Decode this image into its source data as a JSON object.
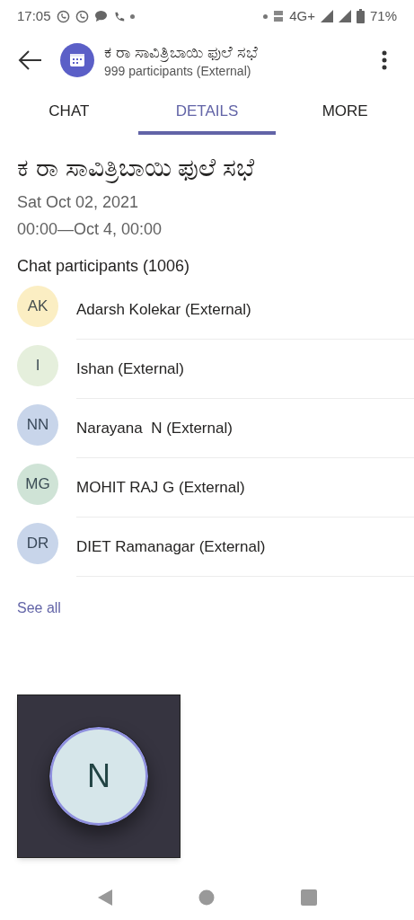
{
  "status_bar": {
    "time": "17:05",
    "network": "4G+",
    "battery": "71%"
  },
  "header": {
    "title": "ಕ ರಾ ಸಾವಿತ್ರಿಬಾಯಿ ಫುಲೆ ಸಭೆ",
    "subtitle": "999 participants (External)"
  },
  "tabs": [
    {
      "label": "CHAT",
      "selected": false
    },
    {
      "label": "DETAILS",
      "selected": true
    },
    {
      "label": "MORE",
      "selected": false
    }
  ],
  "details": {
    "title": "ಕ ರಾ ಸಾವಿತ್ರಿಬಾಯಿ ಫುಲೆ ಸಭೆ",
    "date": "Sat Oct 02, 2021",
    "time": "00:00—Oct 4, 00:00"
  },
  "participants": {
    "heading": "Chat participants (1006)",
    "items": [
      {
        "initials": "AK",
        "name": "Adarsh Kolekar (External)",
        "color": "#fbeec3"
      },
      {
        "initials": "I",
        "name": "Ishan (External)",
        "color": "#e5efdc"
      },
      {
        "initials": "NN",
        "name": "Narayana  N (External)",
        "color": "#c8d5ea"
      },
      {
        "initials": "MG",
        "name": "MOHIT RAJ G (External)",
        "color": "#cfe3d6"
      },
      {
        "initials": "DR",
        "name": "DIET Ramanagar (External)",
        "color": "#c8d5ea"
      }
    ],
    "see_all": "See all"
  },
  "call_tile": {
    "initials": "N"
  }
}
